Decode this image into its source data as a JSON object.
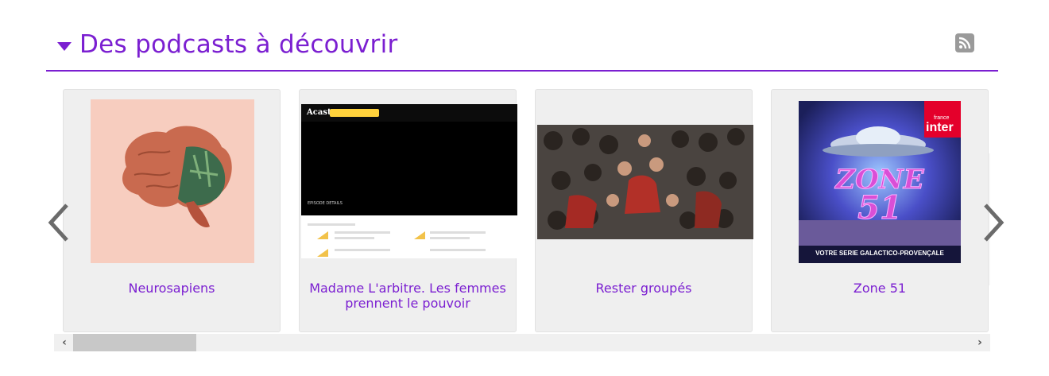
{
  "section": {
    "title": "Des podcasts à découvrir",
    "rss_icon": "rss-icon"
  },
  "cards": [
    {
      "label": "Neurosapiens"
    },
    {
      "label": "Madame L'arbitre. Les femmes prennent le pouvoir"
    },
    {
      "label": "Rester groupés"
    },
    {
      "label": "Zone 51"
    }
  ],
  "thumbs": {
    "acast": {
      "brand": "Acast",
      "episode": "EPISODE DETAILS"
    },
    "zone": {
      "title": "ZONE 51",
      "footer": "VOTRE SERIE GALACTICO-PROVENÇALE",
      "brand_small": "france",
      "brand_big": "inter"
    }
  },
  "nav": {
    "prev": "‹",
    "next": "›",
    "scroll_left": "‹",
    "scroll_right": "›"
  },
  "colors": {
    "accent": "#7b1fd1"
  }
}
